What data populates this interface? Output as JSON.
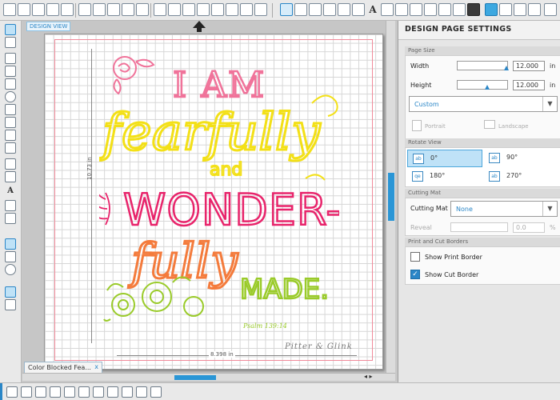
{
  "canvas": {
    "design_view_label": "DESIGN VIEW",
    "width_measure": "8.398 in",
    "height_measure": "10.73 in",
    "credit": "Pitter & Glink",
    "psalm": "Psalm 139:14"
  },
  "artwork": {
    "line1": "I AM",
    "line2": "fearfully",
    "line3": "and",
    "line4": "WONDER-",
    "line5": "fully",
    "line6": "MADE."
  },
  "document_tab": {
    "title": "Color Blocked Fea...",
    "close": "x"
  },
  "tab_nav": "◂ ▸",
  "panel": {
    "title": "DESIGN PAGE SETTINGS",
    "page_size": {
      "header": "Page Size",
      "width_label": "Width",
      "width_value": "12.000",
      "height_label": "Height",
      "height_value": "12.000",
      "unit": "in",
      "preset": "Custom",
      "portrait": "Portrait",
      "landscape": "Landscape"
    },
    "rotate_view": {
      "header": "Rotate View",
      "options": [
        "0°",
        "90°",
        "180°",
        "270°"
      ],
      "selected": "0°"
    },
    "cutting_mat": {
      "header": "Cutting Mat",
      "mat_label": "Cutting Mat",
      "mat_value": "None",
      "reveal_label": "Reveal",
      "reveal_value": "0.0",
      "reveal_unit": "%"
    },
    "borders": {
      "header": "Print and Cut Borders",
      "show_print_border": "Show Print Border",
      "show_print_border_checked": false,
      "show_cut_border": "Show Cut Border",
      "show_cut_border_checked": true
    }
  },
  "colors": {
    "accent": "#2a86c7",
    "pink": "#f0739a",
    "magenta": "#e8246b",
    "yellow": "#f3e017",
    "orange": "#f47b3c",
    "green": "#9acb2a"
  }
}
